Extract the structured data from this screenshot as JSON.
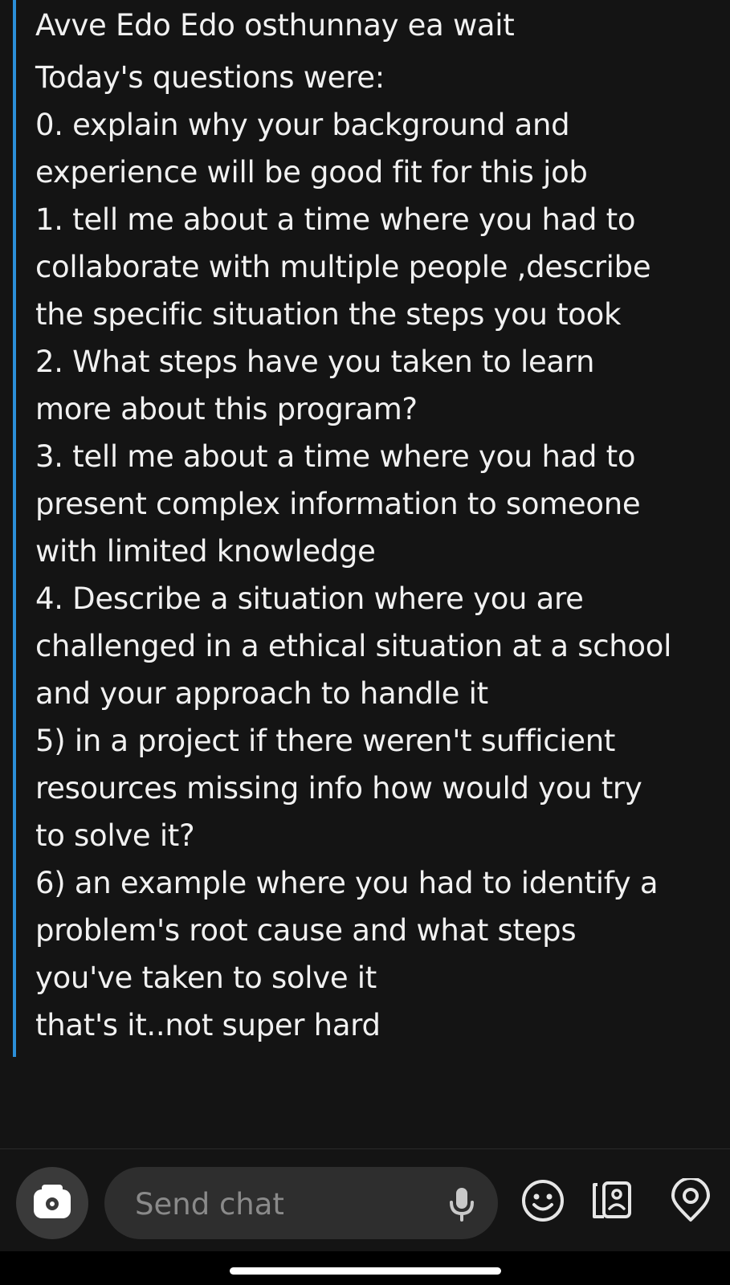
{
  "message": {
    "first_line": "Avve Edo Edo osthunnay ea wait",
    "lines": [
      "Today's questions were:",
      "0. explain why your background and",
      "experience will be good fit for this job",
      "1. tell me about a time where you had to",
      "collaborate with multiple people ,describe",
      "the specific situation the steps you took",
      "2. What steps have you taken to learn",
      "more about this program?",
      "3. tell me about a time where you had to",
      "present complex information to someone",
      "with limited knowledge",
      "4. Describe a situation where you are",
      "challenged in a ethical situation at a school",
      "and your approach to handle it",
      "5) in a project if there weren't sufficient",
      "resources missing info how would you try",
      "to solve it?",
      "6) an example where you had to identify a",
      "problem's root cause and what steps",
      "you've taken to solve it",
      "that's it..not super hard"
    ]
  },
  "composer": {
    "placeholder": "Send chat",
    "icons": [
      "camera-icon",
      "microphone-icon",
      "emoji-icon",
      "sticker-icon",
      "location-icon"
    ]
  },
  "colors": {
    "background": "#141414",
    "accent": "#2b8fd9",
    "text": "#f1f1f1",
    "input_bg": "#2e2e2e"
  }
}
